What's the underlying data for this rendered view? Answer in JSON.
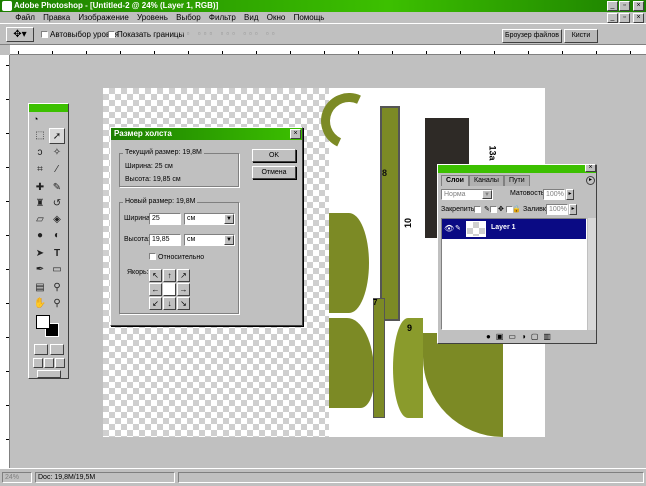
{
  "window": {
    "title": "Adobe Photoshop - [Untitled-2 @ 24% (Layer 1, RGB)]",
    "min": "_",
    "restore": "▫",
    "close": "×",
    "doc_min": "_",
    "doc_restore": "▫",
    "doc_close": "×"
  },
  "menu": [
    "Файл",
    "Правка",
    "Изображение",
    "Уровень",
    "Выбор",
    "Фильтр",
    "Вид",
    "Окно",
    "Помощь"
  ],
  "options": {
    "auto_select": "Автовыбор уровня",
    "show_bounds": "Показать границы",
    "tab_browser": "Броузер файлов",
    "tab_brushes": "Кисти"
  },
  "dialog": {
    "title": "Размер холста",
    "close": "×",
    "current_label": "Текущий размер: 19,8M",
    "current_width": "Ширина: 25 см",
    "current_height": "Высота: 19,85 см",
    "new_label": "Новый размер: 19,8M",
    "width_label": "Ширина:",
    "width_value": "25",
    "width_unit": "см",
    "height_label": "Высота:",
    "height_value": "19,85",
    "height_unit": "см",
    "relative": "Относительно",
    "anchor_label": "Якорь:",
    "ok": "OK",
    "cancel": "Отмена"
  },
  "layers": {
    "tab_layers": "Слои",
    "tab_channels": "Каналы",
    "tab_paths": "Пути",
    "blend_mode": "Норма",
    "opacity_label": "Матовость:",
    "opacity_value": "100%",
    "lock_label": "Закрепить:",
    "fill_label": "Заливка:",
    "fill_value": "100%",
    "layer_name": "Layer 1"
  },
  "status": {
    "zoom": "24%",
    "doc": "Doc: 19,8M/19,5M"
  },
  "artwork": {
    "num_8": "8",
    "num_13a": "13a",
    "num_10": "10",
    "num_7": "7",
    "num_9": "9"
  },
  "colors": {
    "title_green": "#3cc000",
    "olive": "#7c8a25",
    "layer_selected": "#0a0a84"
  }
}
